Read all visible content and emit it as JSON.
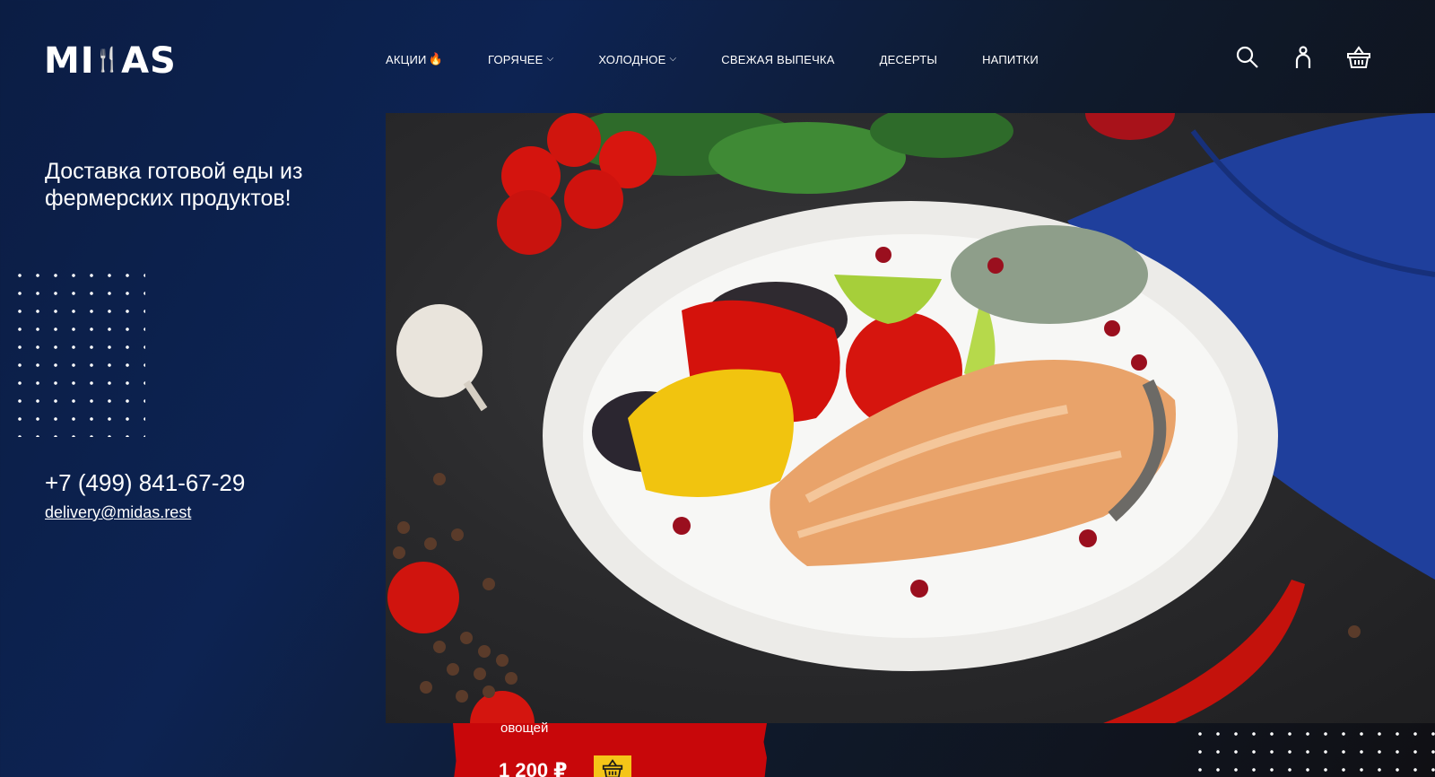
{
  "brand": {
    "logo_text_left": "MI",
    "logo_text_right": "AS"
  },
  "nav": {
    "items": [
      {
        "label": "АКЦИИ",
        "has_fire": true,
        "has_chevron": false
      },
      {
        "label": "ГОРЯЧЕЕ",
        "has_chevron": true
      },
      {
        "label": "ХОЛОДНОЕ",
        "has_chevron": true
      },
      {
        "label": "СВЕЖАЯ ВЫПЕЧКА",
        "has_chevron": false
      },
      {
        "label": "ДЕСЕРТЫ",
        "has_chevron": false
      },
      {
        "label": "НАПИТКИ",
        "has_chevron": false
      }
    ]
  },
  "header_icons": [
    "search-icon",
    "user-icon",
    "cart-icon"
  ],
  "hero": {
    "tagline": "Доставка готовой еды из фермерских продуктов!",
    "phone": "+7 (499) 841-67-29",
    "email": "delivery@midas.rest"
  },
  "product_card": {
    "name_fragment": "овощей",
    "price": "1 200 ₽"
  },
  "colors": {
    "background_dark": "#0d2352",
    "card_red": "#c8070a",
    "cart_yellow": "#f5c518",
    "tablecloth_blue": "#1f3f9c"
  }
}
